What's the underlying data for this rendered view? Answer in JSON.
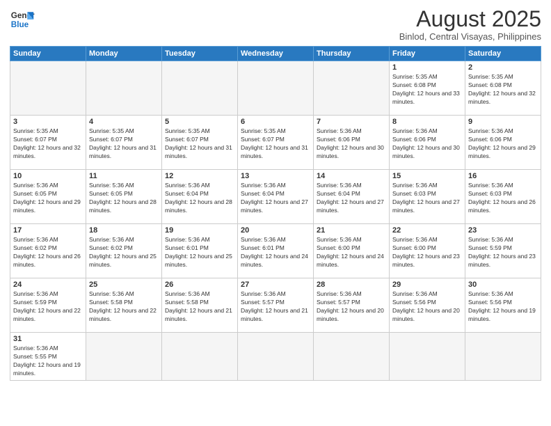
{
  "logo": {
    "text_general": "General",
    "text_blue": "Blue"
  },
  "header": {
    "title": "August 2025",
    "subtitle": "Binlod, Central Visayas, Philippines"
  },
  "weekdays": [
    "Sunday",
    "Monday",
    "Tuesday",
    "Wednesday",
    "Thursday",
    "Friday",
    "Saturday"
  ],
  "weeks": [
    [
      {
        "day": "",
        "info": ""
      },
      {
        "day": "",
        "info": ""
      },
      {
        "day": "",
        "info": ""
      },
      {
        "day": "",
        "info": ""
      },
      {
        "day": "",
        "info": ""
      },
      {
        "day": "1",
        "info": "Sunrise: 5:35 AM\nSunset: 6:08 PM\nDaylight: 12 hours and 33 minutes."
      },
      {
        "day": "2",
        "info": "Sunrise: 5:35 AM\nSunset: 6:08 PM\nDaylight: 12 hours and 32 minutes."
      }
    ],
    [
      {
        "day": "3",
        "info": "Sunrise: 5:35 AM\nSunset: 6:07 PM\nDaylight: 12 hours and 32 minutes."
      },
      {
        "day": "4",
        "info": "Sunrise: 5:35 AM\nSunset: 6:07 PM\nDaylight: 12 hours and 31 minutes."
      },
      {
        "day": "5",
        "info": "Sunrise: 5:35 AM\nSunset: 6:07 PM\nDaylight: 12 hours and 31 minutes."
      },
      {
        "day": "6",
        "info": "Sunrise: 5:35 AM\nSunset: 6:07 PM\nDaylight: 12 hours and 31 minutes."
      },
      {
        "day": "7",
        "info": "Sunrise: 5:36 AM\nSunset: 6:06 PM\nDaylight: 12 hours and 30 minutes."
      },
      {
        "day": "8",
        "info": "Sunrise: 5:36 AM\nSunset: 6:06 PM\nDaylight: 12 hours and 30 minutes."
      },
      {
        "day": "9",
        "info": "Sunrise: 5:36 AM\nSunset: 6:06 PM\nDaylight: 12 hours and 29 minutes."
      }
    ],
    [
      {
        "day": "10",
        "info": "Sunrise: 5:36 AM\nSunset: 6:05 PM\nDaylight: 12 hours and 29 minutes."
      },
      {
        "day": "11",
        "info": "Sunrise: 5:36 AM\nSunset: 6:05 PM\nDaylight: 12 hours and 28 minutes."
      },
      {
        "day": "12",
        "info": "Sunrise: 5:36 AM\nSunset: 6:04 PM\nDaylight: 12 hours and 28 minutes."
      },
      {
        "day": "13",
        "info": "Sunrise: 5:36 AM\nSunset: 6:04 PM\nDaylight: 12 hours and 27 minutes."
      },
      {
        "day": "14",
        "info": "Sunrise: 5:36 AM\nSunset: 6:04 PM\nDaylight: 12 hours and 27 minutes."
      },
      {
        "day": "15",
        "info": "Sunrise: 5:36 AM\nSunset: 6:03 PM\nDaylight: 12 hours and 27 minutes."
      },
      {
        "day": "16",
        "info": "Sunrise: 5:36 AM\nSunset: 6:03 PM\nDaylight: 12 hours and 26 minutes."
      }
    ],
    [
      {
        "day": "17",
        "info": "Sunrise: 5:36 AM\nSunset: 6:02 PM\nDaylight: 12 hours and 26 minutes."
      },
      {
        "day": "18",
        "info": "Sunrise: 5:36 AM\nSunset: 6:02 PM\nDaylight: 12 hours and 25 minutes."
      },
      {
        "day": "19",
        "info": "Sunrise: 5:36 AM\nSunset: 6:01 PM\nDaylight: 12 hours and 25 minutes."
      },
      {
        "day": "20",
        "info": "Sunrise: 5:36 AM\nSunset: 6:01 PM\nDaylight: 12 hours and 24 minutes."
      },
      {
        "day": "21",
        "info": "Sunrise: 5:36 AM\nSunset: 6:00 PM\nDaylight: 12 hours and 24 minutes."
      },
      {
        "day": "22",
        "info": "Sunrise: 5:36 AM\nSunset: 6:00 PM\nDaylight: 12 hours and 23 minutes."
      },
      {
        "day": "23",
        "info": "Sunrise: 5:36 AM\nSunset: 5:59 PM\nDaylight: 12 hours and 23 minutes."
      }
    ],
    [
      {
        "day": "24",
        "info": "Sunrise: 5:36 AM\nSunset: 5:59 PM\nDaylight: 12 hours and 22 minutes."
      },
      {
        "day": "25",
        "info": "Sunrise: 5:36 AM\nSunset: 5:58 PM\nDaylight: 12 hours and 22 minutes."
      },
      {
        "day": "26",
        "info": "Sunrise: 5:36 AM\nSunset: 5:58 PM\nDaylight: 12 hours and 21 minutes."
      },
      {
        "day": "27",
        "info": "Sunrise: 5:36 AM\nSunset: 5:57 PM\nDaylight: 12 hours and 21 minutes."
      },
      {
        "day": "28",
        "info": "Sunrise: 5:36 AM\nSunset: 5:57 PM\nDaylight: 12 hours and 20 minutes."
      },
      {
        "day": "29",
        "info": "Sunrise: 5:36 AM\nSunset: 5:56 PM\nDaylight: 12 hours and 20 minutes."
      },
      {
        "day": "30",
        "info": "Sunrise: 5:36 AM\nSunset: 5:56 PM\nDaylight: 12 hours and 19 minutes."
      }
    ],
    [
      {
        "day": "31",
        "info": "Sunrise: 5:36 AM\nSunset: 5:55 PM\nDaylight: 12 hours and 19 minutes."
      },
      {
        "day": "",
        "info": ""
      },
      {
        "day": "",
        "info": ""
      },
      {
        "day": "",
        "info": ""
      },
      {
        "day": "",
        "info": ""
      },
      {
        "day": "",
        "info": ""
      },
      {
        "day": "",
        "info": ""
      }
    ]
  ]
}
